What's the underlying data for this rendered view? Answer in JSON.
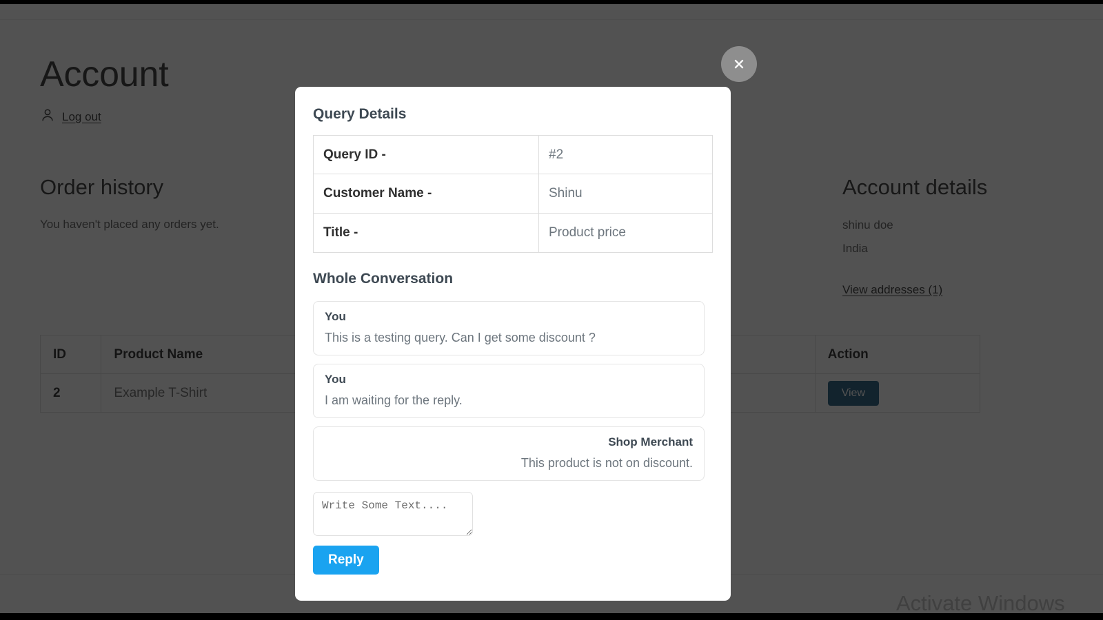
{
  "page": {
    "title": "Account",
    "logout_label": "Log out",
    "order_history": {
      "heading": "Order history",
      "empty_text": "You haven't placed any orders yet."
    },
    "account_details": {
      "heading": "Account details",
      "name": "shinu doe",
      "country": "India",
      "view_addresses_label": "View addresses (1)"
    },
    "queries_table": {
      "headers": [
        "ID",
        "Product Name",
        "",
        "",
        "Action"
      ],
      "rows": [
        {
          "id": "2",
          "product_name": "Example T-Shirt",
          "mid_a": "",
          "mid_b": "",
          "action_label": "View"
        }
      ]
    },
    "watermark": "Activate Windows"
  },
  "modal": {
    "close_label": "×",
    "details_heading": "Query Details",
    "details_rows": [
      {
        "label": "Query ID -",
        "value": "#2"
      },
      {
        "label": "Customer Name -",
        "value": "Shinu"
      },
      {
        "label": "Title -",
        "value": "Product price"
      }
    ],
    "conversation_heading": "Whole Conversation",
    "messages": [
      {
        "who": "You",
        "body": "This is a testing query. Can I get some discount ?",
        "side": "left"
      },
      {
        "who": "You",
        "body": "I am waiting for the reply.",
        "side": "left"
      },
      {
        "who": "Shop Merchant",
        "body": "This product is not on discount.",
        "side": "right"
      }
    ],
    "reply_placeholder": "Write Some Text....",
    "reply_value": "",
    "reply_button_label": "Reply"
  },
  "colors": {
    "reply_button": "#1aa3f0",
    "view_button": "#0b4a6f",
    "overlay": "#161616",
    "heading_text": "#3d4852",
    "muted_text": "#6c757d"
  }
}
